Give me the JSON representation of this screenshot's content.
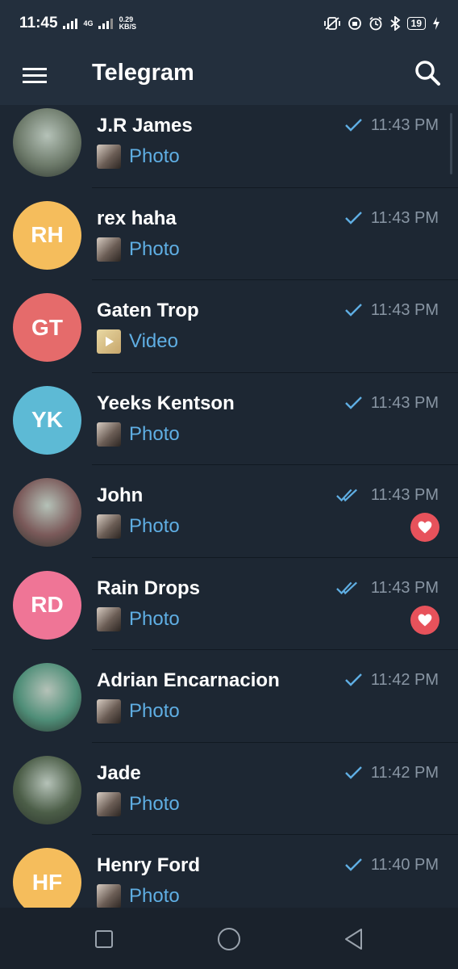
{
  "status_bar": {
    "time": "11:45",
    "network": "4G",
    "speed_value": "0.29",
    "speed_unit": "KB/S",
    "battery": "19",
    "icons": [
      "vibrate-icon",
      "data-saver-icon",
      "alarm-icon",
      "bluetooth-icon",
      "battery-icon",
      "charging-icon"
    ]
  },
  "app_bar": {
    "title": "Telegram",
    "menu_icon": "hamburger-menu-icon",
    "search_icon": "search-icon"
  },
  "chats": [
    {
      "name": "J.R James",
      "initials": "",
      "avatar": "photo",
      "avatar_color": "#6d7a6a",
      "preview_type": "Photo",
      "time": "11:43 PM",
      "ticks": 1,
      "reaction": false
    },
    {
      "name": "rex haha",
      "initials": "RH",
      "avatar": "initials",
      "avatar_color": "#f5bd5c",
      "preview_type": "Photo",
      "time": "11:43 PM",
      "ticks": 1,
      "reaction": false
    },
    {
      "name": "Gaten Trop",
      "initials": "GT",
      "avatar": "initials",
      "avatar_color": "#e56b6b",
      "preview_type": "Video",
      "time": "11:43 PM",
      "ticks": 1,
      "reaction": false
    },
    {
      "name": "Yeeks Kentson",
      "initials": "YK",
      "avatar": "initials",
      "avatar_color": "#5dbad5",
      "preview_type": "Photo",
      "time": "11:43 PM",
      "ticks": 1,
      "reaction": false
    },
    {
      "name": "John",
      "initials": "",
      "avatar": "photo",
      "avatar_color": "#7b5a5a",
      "preview_type": "Photo",
      "time": "11:43 PM",
      "ticks": 2,
      "reaction": true
    },
    {
      "name": "Rain Drops",
      "initials": "RD",
      "avatar": "initials",
      "avatar_color": "#ef7596",
      "preview_type": "Photo",
      "time": "11:43 PM",
      "ticks": 2,
      "reaction": true
    },
    {
      "name": "Adrian Encarnacion",
      "initials": "",
      "avatar": "photo",
      "avatar_color": "#4f8e78",
      "preview_type": "Photo",
      "time": "11:42 PM",
      "ticks": 1,
      "reaction": false
    },
    {
      "name": "Jade",
      "initials": "",
      "avatar": "photo",
      "avatar_color": "#4c5e48",
      "preview_type": "Photo",
      "time": "11:42 PM",
      "ticks": 1,
      "reaction": false
    },
    {
      "name": "Henry Ford",
      "initials": "HF",
      "avatar": "initials",
      "avatar_color": "#f5bd5c",
      "preview_type": "Photo",
      "time": "11:40 PM",
      "ticks": 1,
      "reaction": false
    }
  ],
  "nav_bar": {
    "icons": [
      "recents-square-icon",
      "home-circle-icon",
      "back-triangle-icon"
    ]
  }
}
